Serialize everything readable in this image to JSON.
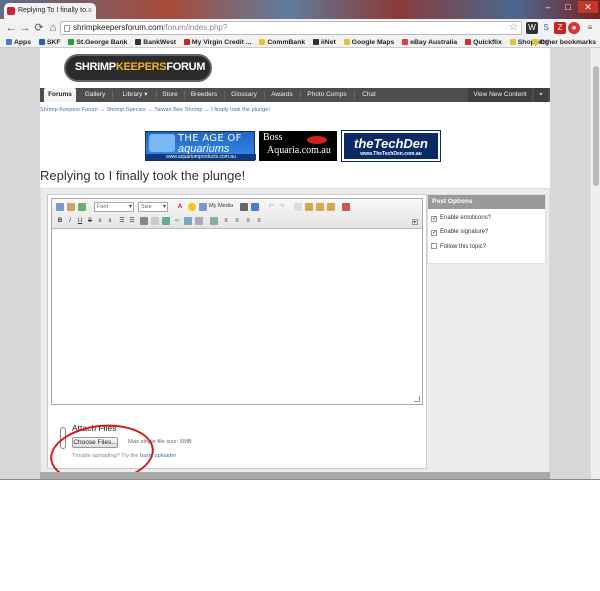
{
  "browser": {
    "tab_title": "Replying To I finally to...",
    "tab_close": "×",
    "url_main": "shrimpkeepersforum.com",
    "url_rest": "/forum/index.php?",
    "bookmarks": [
      {
        "label": "Apps",
        "color": "#4a7bd0"
      },
      {
        "label": "SKF",
        "color": "#2a5db0"
      },
      {
        "label": "St.George Bank",
        "color": "#2a9a3a"
      },
      {
        "label": "BankWest",
        "color": "#333333"
      },
      {
        "label": "My Virgin Credit ...",
        "color": "#d02020"
      },
      {
        "label": "CommBank",
        "color": "#f0c020"
      },
      {
        "label": "iiNet",
        "color": "#333333"
      },
      {
        "label": "Google Maps",
        "color": "#e0c040"
      },
      {
        "label": "eBay Australia",
        "color": "#e04040"
      },
      {
        "label": "Quickflix",
        "color": "#d03030"
      },
      {
        "label": "Shopping",
        "color": "#e0c040"
      }
    ],
    "other_bookmarks": "Other bookmarks"
  },
  "site": {
    "logo_part1": "SHRIMP",
    "logo_part2": "KEEPERS",
    "logo_part3": "FORUM",
    "nav": [
      {
        "label": "Forums",
        "active": true
      },
      {
        "label": "Gallery",
        "active": false
      },
      {
        "label": "Library ▾",
        "active": false
      },
      {
        "label": "Store",
        "active": false
      },
      {
        "label": "Breeders",
        "active": false
      },
      {
        "label": "Glossary",
        "active": false
      },
      {
        "label": "Awards",
        "active": false
      },
      {
        "label": "Photo Comps",
        "active": false
      },
      {
        "label": "Chat",
        "active": false
      }
    ],
    "view_new_content": "View New Content",
    "breadcrumb": "Shrimp Keepers Forum  →  Shrimp Species  →  Taiwan Bee Shrimp  →  I finally took the plunge!"
  },
  "ads": {
    "ad1_line1": "THE AGE OF",
    "ad1_line2": "aquariums",
    "ad1_url": "www.aquariumproducts.com.au",
    "ad2_line1": "Boss",
    "ad2_line2": "Aquaria.com.au",
    "ad3_line1": "theTechDen",
    "ad3_url": "www.TheTechDen.com.au"
  },
  "page": {
    "heading": "Replying to I finally took the plunge!"
  },
  "editor": {
    "font_select": "Font",
    "size_select": "Size",
    "my_media": "My Media"
  },
  "attach": {
    "title": "Attach Files",
    "choose_button": "Choose Files...",
    "max_size": "Max single file size: 5MB",
    "trouble_prefix": "Trouble uploading? Try the ",
    "trouble_link": "basic uploader"
  },
  "post_options": {
    "title": "Post Options",
    "items": [
      {
        "label": "Enable emoticons?",
        "checked": true
      },
      {
        "label": "Enable signature?",
        "checked": true
      },
      {
        "label": "Follow this topic?",
        "checked": false
      }
    ]
  }
}
